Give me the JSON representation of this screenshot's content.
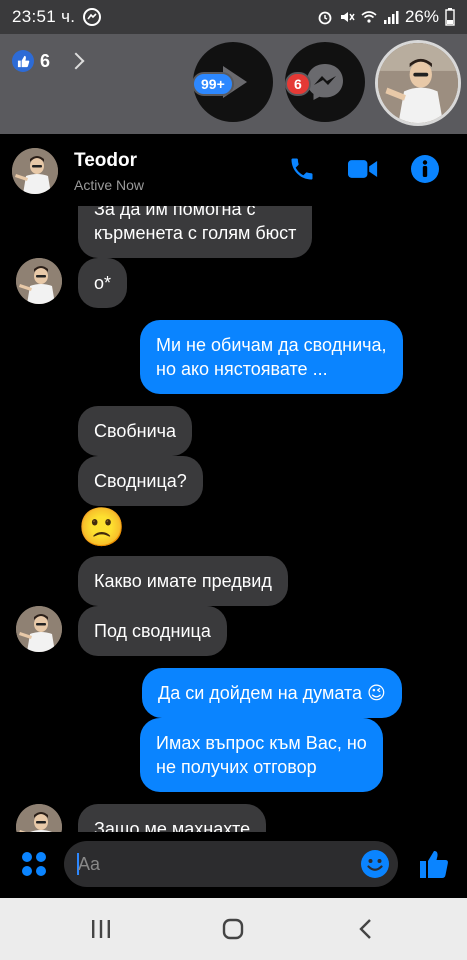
{
  "status_bar": {
    "time": "23:51 ч.",
    "battery": "26%",
    "icons": [
      "messenger-icon",
      "alarm-icon",
      "mute-icon",
      "wifi-icon",
      "signal-icon",
      "battery-icon"
    ]
  },
  "overlay": {
    "likes_count": "6",
    "heads": [
      {
        "name": "play-head",
        "badge": "99+"
      },
      {
        "name": "messenger-head",
        "badge": "6"
      },
      {
        "name": "contact-head",
        "badge": ""
      }
    ]
  },
  "chat": {
    "contact_name": "Teodor",
    "contact_status": "Active Now",
    "messages": [
      {
        "dir": "in",
        "text_line1": "За да им помогна с",
        "text_line2": "кърменета с голям бюст"
      },
      {
        "dir": "in",
        "text": "о*"
      },
      {
        "dir": "out",
        "text_line1": "Ми не обичам да сводничa,",
        "text_line2": "но ако нястоявате ..."
      },
      {
        "dir": "in",
        "text": "Свобнича"
      },
      {
        "dir": "in",
        "text": "Сводница?"
      },
      {
        "dir": "in",
        "emoji": "🙁"
      },
      {
        "dir": "in",
        "text": "Какво имате предвид"
      },
      {
        "dir": "in",
        "text": "Под сводница"
      },
      {
        "dir": "out",
        "text": "Да си дойдем на думата 😉"
      },
      {
        "dir": "out",
        "text_line1": "Имах въпрос към Вас, но",
        "text_line2": "не получих отговор"
      },
      {
        "dir": "in",
        "text": "Защо ме махнахте"
      }
    ]
  },
  "input": {
    "placeholder": "Aa"
  },
  "colors": {
    "accent": "#0a84ff",
    "incoming_bubble": "#3a3a3c",
    "background": "#000000"
  }
}
